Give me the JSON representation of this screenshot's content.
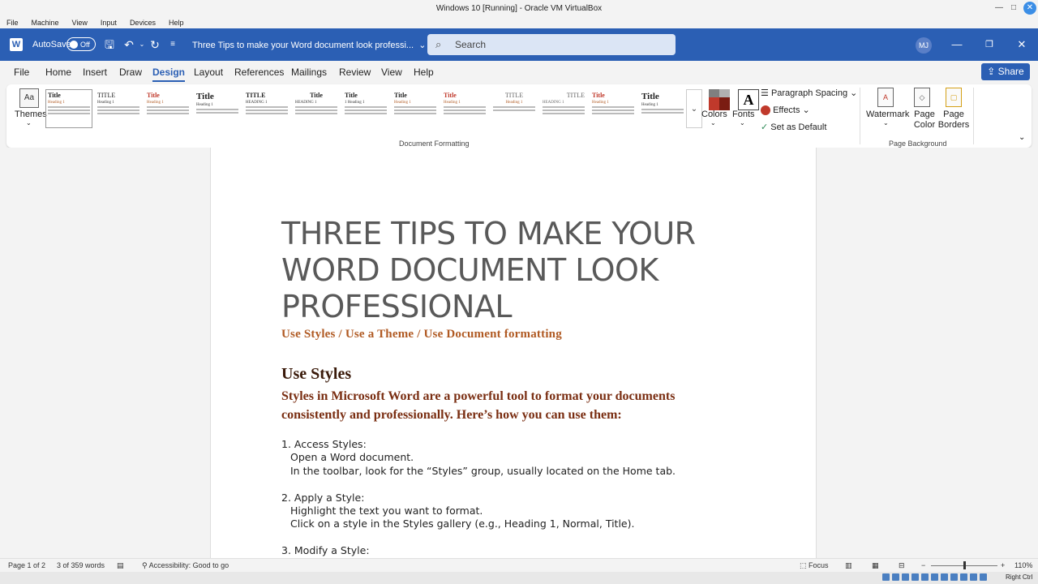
{
  "vbox": {
    "title": "Windows 10 [Running] - Oracle VM VirtualBox",
    "menu": [
      "File",
      "Machine",
      "View",
      "Input",
      "Devices",
      "Help"
    ],
    "host_key": "Right Ctrl"
  },
  "word": {
    "autosave_label": "AutoSave",
    "autosave_state": "Off",
    "doc_title": "Three Tips to make your Word document look professi...",
    "search_placeholder": "Search",
    "user_initials": "MJ",
    "tabs": [
      "File",
      "Home",
      "Insert",
      "Draw",
      "Design",
      "Layout",
      "References",
      "Mailings",
      "Review",
      "View",
      "Help"
    ],
    "active_tab": "Design",
    "share_label": "Share"
  },
  "ribbon": {
    "themes_label": "Themes",
    "colors_label": "Colors",
    "fonts_label": "Fonts",
    "paragraph_spacing": "Paragraph Spacing",
    "effects": "Effects",
    "set_default": "Set as Default",
    "watermark": "Watermark",
    "page_color": "Page Color",
    "page_borders": "Page Borders",
    "group_doc_formatting": "Document Formatting",
    "group_page_background": "Page Background",
    "style_thumbs": [
      {
        "title": "Title",
        "heading": "Heading 1"
      },
      {
        "title": "TITLE",
        "heading": "Heading 1"
      },
      {
        "title": "Title",
        "heading": "Heading 1"
      },
      {
        "title": "Title",
        "heading": "Heading 1"
      },
      {
        "title": "TITLE",
        "heading": "HEADING 1"
      },
      {
        "title": "Title",
        "heading": "HEADING 1"
      },
      {
        "title": "Title",
        "heading": "1 Heading 1"
      },
      {
        "title": "Title",
        "heading": "Heading 1"
      },
      {
        "title": "Title",
        "heading": "Heading 1"
      },
      {
        "title": "TITLE",
        "heading": "Heading 1"
      },
      {
        "title": "TITLE",
        "heading": "HEADING 1"
      },
      {
        "title": "Title",
        "heading": "Heading 1"
      },
      {
        "title": "Title",
        "heading": "Heading 1"
      }
    ]
  },
  "document": {
    "title": "THREE TIPS TO MAKE YOUR WORD DOCUMENT LOOK PROFESSIONAL",
    "subtitle": "Use Styles / Use a Theme / Use Document formatting",
    "heading1": "Use Styles",
    "lead": "Styles in Microsoft Word are a powerful tool to format your documents consistently and professionally. Here’s how you can use them:",
    "lines": [
      "1. Access Styles:",
      "Open a Word document.",
      "In the toolbar, look for the “Styles” group, usually located on the Home tab.",
      "2. Apply a Style:",
      "Highlight the text you want to format.",
      "Click on a style in the Styles gallery (e.g., Heading 1, Normal, Title).",
      "3. Modify a Style:"
    ]
  },
  "status": {
    "page": "Page 1 of 2",
    "words": "3 of 359 words",
    "accessibility": "Accessibility: Good to go",
    "focus": "Focus",
    "zoom": "110%"
  },
  "colors": {
    "accent": "#2b5fb4",
    "subtitle": "#b05a23",
    "title_gray": "#595959"
  }
}
